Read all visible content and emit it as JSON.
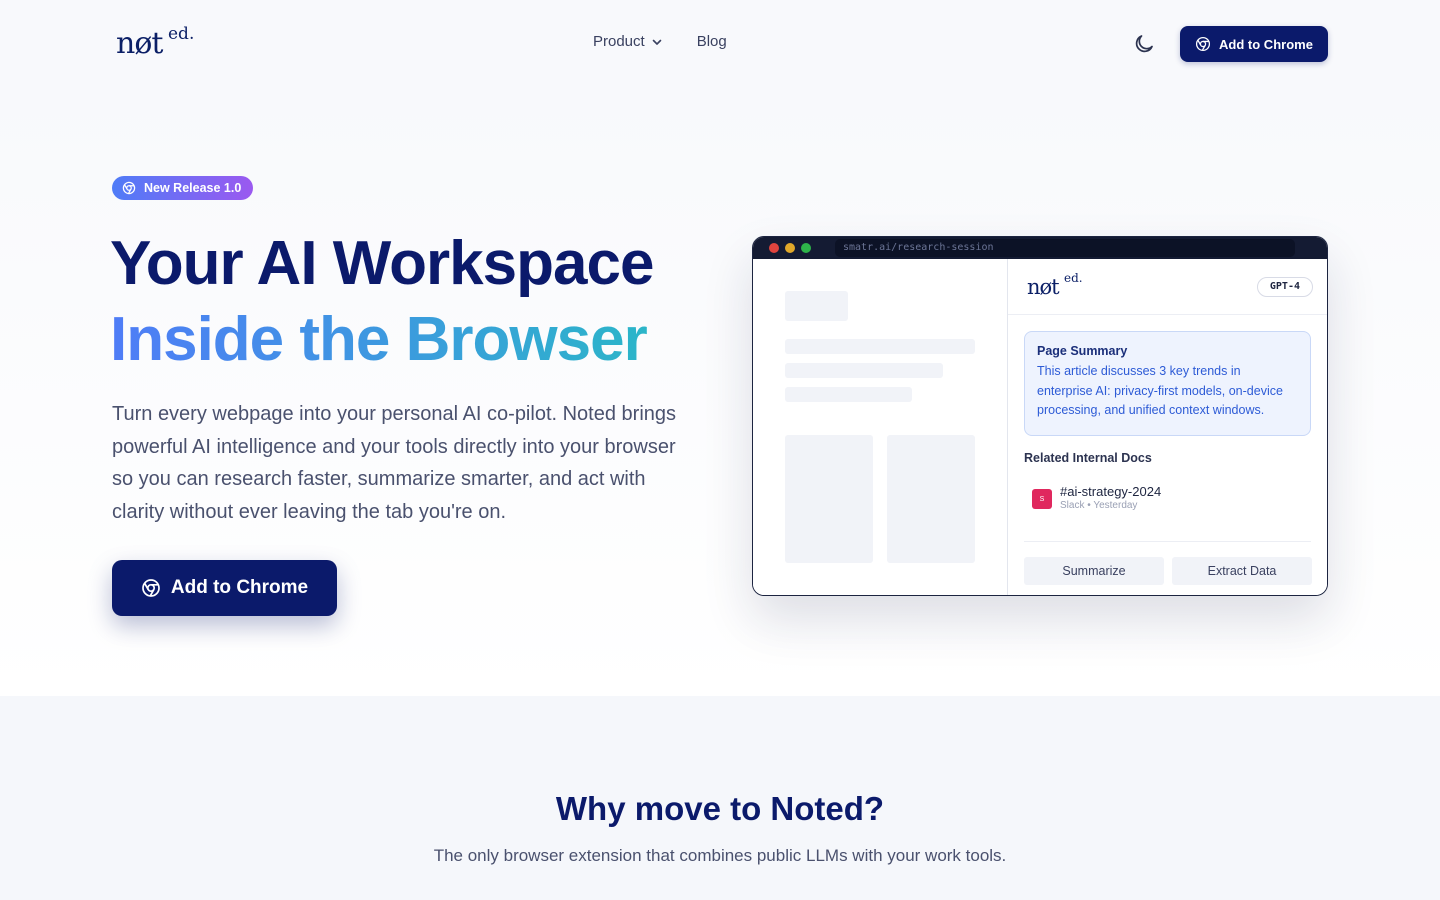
{
  "nav": {
    "logo_main": "nøt",
    "logo_sup": "ed.",
    "links": [
      {
        "label": "Product"
      },
      {
        "label": "Blog"
      }
    ],
    "cta_label": "Add to Chrome"
  },
  "hero": {
    "badge": "New Release 1.0",
    "title_line1": "Your AI Workspace",
    "title_line2": "Inside the Browser",
    "description": "Turn every webpage into your personal AI co-pilot. Noted brings powerful AI intelligence and your tools directly into your browser so you can research faster, summarize smarter, and act with clarity without ever leaving the tab you're on.",
    "cta_label": "Add to Chrome"
  },
  "mockup": {
    "url": "smatr.ai/research-session",
    "logo_main": "nøt",
    "logo_sup": "ed.",
    "model": "GPT-4",
    "summary_title": "Page Summary",
    "summary_text": "This article discusses 3 key trends in enterprise AI: privacy-first models, on-device processing, and unified context windows.",
    "related_title": "Related Internal Docs",
    "doc": {
      "icon_letter": "S",
      "name": "#ai-strategy-2024",
      "meta": "Slack • Yesterday"
    },
    "actions": [
      "Summarize",
      "Extract Data"
    ]
  },
  "why": {
    "title": "Why move to Noted?",
    "subtitle": "The only browser extension that combines public LLMs with your work tools."
  },
  "colors": {
    "brand_navy": "#0b1a6b",
    "gradient_start": "#4f7cf7",
    "gradient_end": "#2bb6c8",
    "badge_end": "#9b59f0"
  }
}
